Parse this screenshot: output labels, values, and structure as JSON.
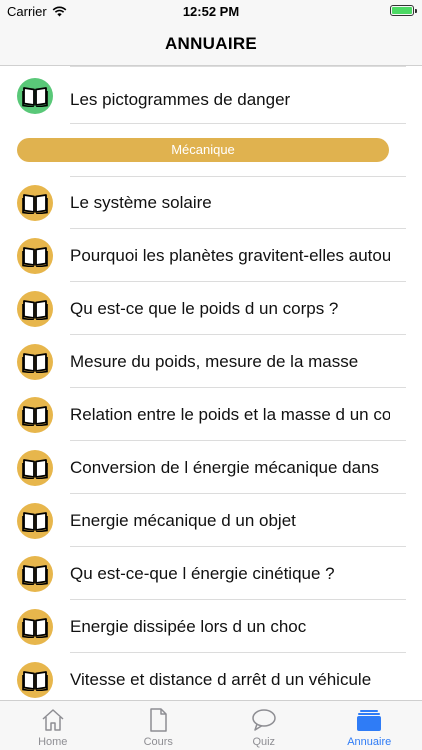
{
  "status_bar": {
    "carrier": "Carrier",
    "time": "12:52 PM"
  },
  "nav": {
    "title": "ANNUAIRE"
  },
  "list": {
    "top_item": {
      "label": "Les pictogrammes de danger",
      "icon": "book-icon",
      "icon_color": "#59c878"
    },
    "section": {
      "title": "Mécanique",
      "color": "#e0b24f"
    },
    "items": [
      {
        "label": "Le système solaire",
        "icon": "book-icon",
        "icon_color": "#e7b64c"
      },
      {
        "label": "Pourquoi les planètes gravitent-elles autour",
        "icon": "book-icon",
        "icon_color": "#e7b64c"
      },
      {
        "label": "Qu est-ce que le poids d un corps ?",
        "icon": "book-icon",
        "icon_color": "#e7b64c"
      },
      {
        "label": "Mesure du poids, mesure de la masse",
        "icon": "book-icon",
        "icon_color": "#e7b64c"
      },
      {
        "label": "Relation entre le poids et la masse d un corps",
        "icon": "book-icon",
        "icon_color": "#e7b64c"
      },
      {
        "label": "Conversion de l énergie mécanique dans",
        "icon": "book-icon",
        "icon_color": "#e7b64c"
      },
      {
        "label": "Energie mécanique d un objet",
        "icon": "book-icon",
        "icon_color": "#e7b64c"
      },
      {
        "label": "Qu est-ce-que l énergie cinétique ?",
        "icon": "book-icon",
        "icon_color": "#e7b64c"
      },
      {
        "label": "Energie dissipée lors d un choc",
        "icon": "book-icon",
        "icon_color": "#e7b64c"
      },
      {
        "label": "Vitesse et distance d arrêt d un véhicule",
        "icon": "book-icon",
        "icon_color": "#e7b64c"
      }
    ]
  },
  "tab_bar": {
    "tabs": [
      {
        "label": "Home",
        "icon": "home-icon",
        "active": false
      },
      {
        "label": "Cours",
        "icon": "document-icon",
        "active": false
      },
      {
        "label": "Quiz",
        "icon": "speech-bubble-icon",
        "active": false
      },
      {
        "label": "Annuaire",
        "icon": "folder-icon",
        "active": true
      }
    ],
    "active_color": "#2f7cf6",
    "inactive_color": "#8e8e93"
  }
}
